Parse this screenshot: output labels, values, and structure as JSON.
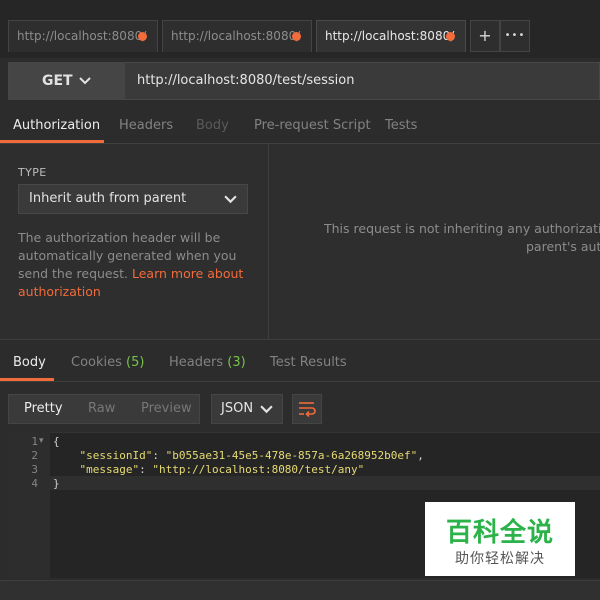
{
  "tabs": [
    {
      "label": "http://localhost:8080/",
      "active": false
    },
    {
      "label": "http://localhost:8080/",
      "active": false
    },
    {
      "label": "http://localhost:8080/",
      "active": true
    }
  ],
  "tab_actions": {
    "add": "+",
    "more": "•••"
  },
  "request": {
    "method": "GET",
    "url": "http://localhost:8080/test/session"
  },
  "request_tabs": [
    "Authorization",
    "Headers",
    "Body",
    "Pre-request Script",
    "Tests"
  ],
  "auth": {
    "type_label": "TYPE",
    "type_value": "Inherit auth from parent",
    "description": "The authorization header will be automatically generated when you send the request.",
    "link_text": "Learn more about authorization",
    "right_message_line1": "This request is not inheriting any authorization he",
    "right_message_line2": "parent's auth"
  },
  "response_tabs": [
    {
      "label": "Body",
      "count": ""
    },
    {
      "label": "Cookies",
      "count": "(5)"
    },
    {
      "label": "Headers",
      "count": "(3)"
    },
    {
      "label": "Test Results",
      "count": ""
    }
  ],
  "format": {
    "options": [
      "Pretty",
      "Raw",
      "Preview"
    ],
    "selected": "Pretty",
    "language": "JSON"
  },
  "code": {
    "line_numbers": [
      "1",
      "2",
      "3",
      "4"
    ],
    "open_brace": "{",
    "close_brace": "}",
    "key1": "\"sessionId\"",
    "value1": "\"b055ae31-45e5-478e-857a-6a268952b0ef\"",
    "key2": "\"message\"",
    "value2": "\"http://localhost:8080/test/any\""
  },
  "watermark": {
    "title": "百科全说",
    "subtitle": "助你轻松解决"
  },
  "colors": {
    "accent": "#f26b3a",
    "count_green": "#73c34a",
    "string": "#e6db74"
  }
}
